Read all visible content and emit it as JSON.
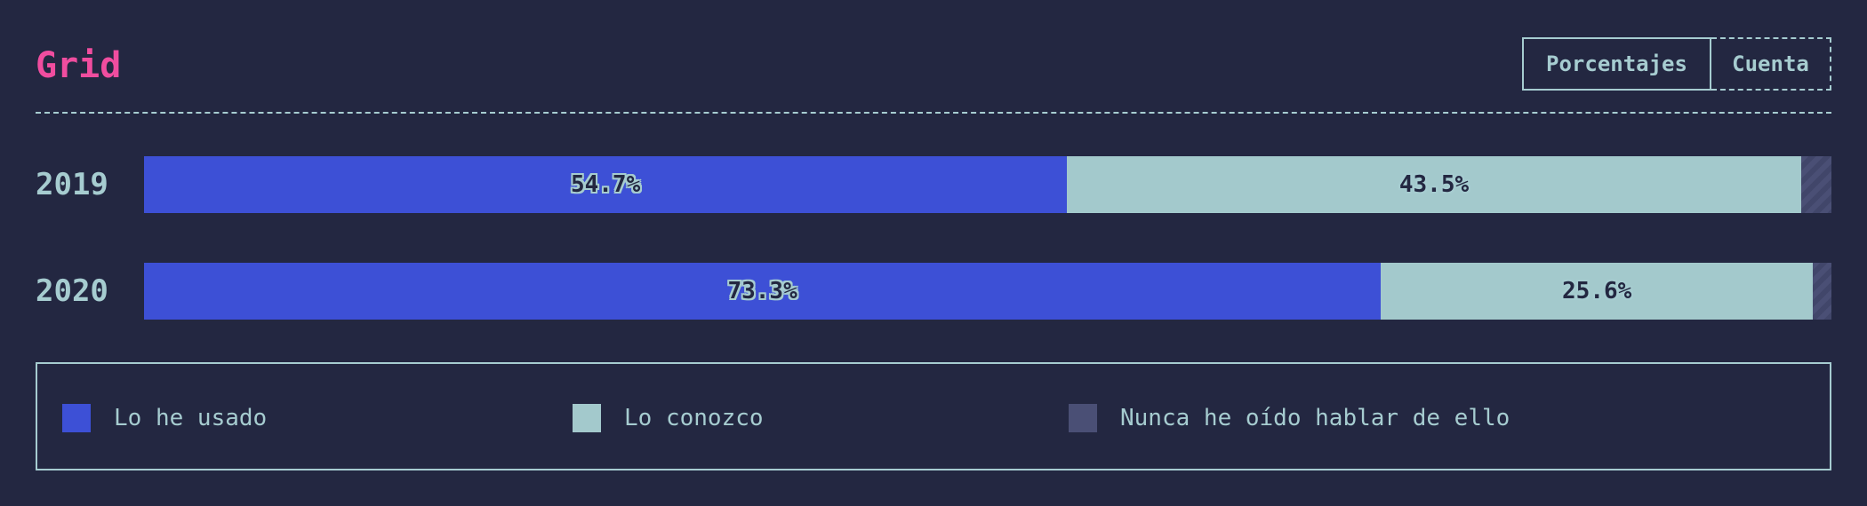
{
  "title": "Grid",
  "toggle": {
    "percentages_label": "Porcentajes",
    "count_label": "Cuenta"
  },
  "colors": {
    "background": "#232741",
    "title": "#f04d9f",
    "used": "#3d50d6",
    "known": "#a3c9cc",
    "never": "#4a4f75",
    "text": "#a6ccd0"
  },
  "chart_data": {
    "type": "bar",
    "stacked": true,
    "orientation": "horizontal",
    "categories": [
      "2019",
      "2020"
    ],
    "series": [
      {
        "name": "Lo he usado",
        "values": [
          54.7,
          73.3
        ],
        "labels": [
          "54.7%",
          "73.3%"
        ]
      },
      {
        "name": "Lo conozco",
        "values": [
          43.5,
          25.6
        ],
        "labels": [
          "43.5%",
          "25.6%"
        ]
      },
      {
        "name": "Nunca he oído hablar de ello",
        "values": [
          1.8,
          1.1
        ],
        "labels": [
          "",
          ""
        ]
      }
    ],
    "xlim": [
      0,
      100
    ],
    "legend_position": "bottom"
  },
  "legend": [
    {
      "label": "Lo he usado",
      "icon": "square"
    },
    {
      "label": "Lo conozco",
      "icon": "square"
    },
    {
      "label": "Nunca he oído hablar de ello",
      "icon": "square"
    }
  ]
}
